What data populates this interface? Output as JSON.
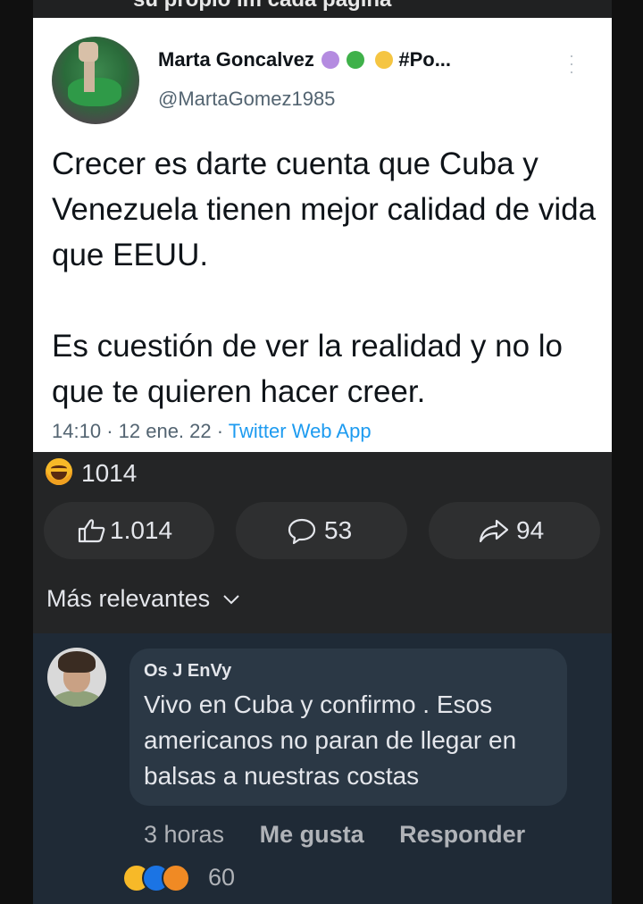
{
  "top_caption": "su propio im cada pagina",
  "tweet": {
    "author_name": "Marta Goncalvez",
    "author_suffix": "#Po...",
    "handle": "@MartaGomez1985",
    "paragraphs": [
      "Crecer es darte cuenta que Cuba y Venezuela tienen mejor calidad de vida que EEUU.",
      "Es cuestión de ver la realidad y no lo que te quieren hacer creer."
    ],
    "time": "14:10",
    "date": "12 ene. 22",
    "source": "Twitter Web App"
  },
  "post": {
    "reaction_count": "1014",
    "like_count": "1.014",
    "comment_count": "53",
    "share_count": "94",
    "sort_label": "Más relevantes"
  },
  "comment": {
    "name": "Os J EnVy",
    "text": "Vivo en Cuba y confirmo . Esos americanos no paran de llegar en balsas a nuestras costas",
    "time": "3 horas",
    "like_label": "Me gusta",
    "reply_label": "Responder",
    "reaction_count": "60"
  },
  "colors": {
    "tweet_bg": "#ffffff",
    "link_blue": "#1d9bf0",
    "dark_bg": "#242526",
    "comment_bg": "#1f2a36",
    "bubble_bg": "#2b3845"
  }
}
